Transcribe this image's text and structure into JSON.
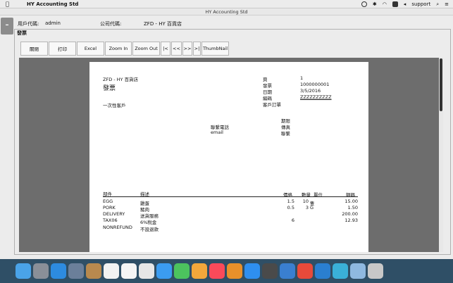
{
  "menubar": {
    "app_name": "HY Accounting Std",
    "user": "support"
  },
  "window": {
    "title": "HY Accounting Std"
  },
  "info": {
    "user_label": "用戶代碼:",
    "user_value": "admin",
    "company_label": "公司代碼:",
    "company_value": "ZFD - HY 百貨店"
  },
  "panel": {
    "title": "發票"
  },
  "toolbar": {
    "close": "關閉",
    "print": "打印",
    "excel": "Excel",
    "zoom_in": "Zoom In",
    "zoom_out": "Zoom Out",
    "first": "|<",
    "prev": "<<",
    "next": ">>",
    "last": ">|",
    "thumbnail": "ThumbNail"
  },
  "report": {
    "company": "ZFD - HY 百貨店",
    "doc_title": "發票",
    "customer": "一次性客戶",
    "page_label": "頁",
    "page_value": "1",
    "invoice_label": "發票",
    "invoice_value": "1000000001",
    "date_label": "日期",
    "date_value": "3/5/2016",
    "code_label": "編碼",
    "code_value": "ZZZZZZZZZZ",
    "cust_order_label": "客戶訂單",
    "due_label": "期限",
    "fax_label": "傳真",
    "contact_label": "聯繫",
    "phone_label": "聯繫電話",
    "email_label": "email",
    "col_part": "部件",
    "col_desc": "描述",
    "col_price": "價格",
    "col_qty": "數量",
    "col_unit": "單位",
    "col_amount": "額碼",
    "lines": [
      {
        "part": "EGG",
        "desc": "雞蛋",
        "price": "1.5",
        "qty": "10",
        "unit": "隻",
        "amount": "15.00"
      },
      {
        "part": "PORK",
        "desc": "豬肉",
        "price": "0.5",
        "qty": "3",
        "unit": "G",
        "amount": "1.50"
      },
      {
        "part": "DELIVERY",
        "desc": "送貨服務",
        "price": "",
        "qty": "",
        "unit": "",
        "amount": "200.00"
      },
      {
        "part": "TAX06",
        "desc": "6%稅金",
        "price": "6",
        "qty": "",
        "unit": "",
        "amount": "12.93"
      },
      {
        "part": "NONREFUND",
        "desc": "不設退款",
        "price": "",
        "qty": "",
        "unit": "",
        "amount": ""
      }
    ]
  },
  "dock": {
    "colors": [
      "#4aa3e8",
      "#8a8f98",
      "#2d8be0",
      "#6b7f9a",
      "#b8894e",
      "#f2f2f2",
      "#f5f5f5",
      "#e6e6e6",
      "#3b9cf0",
      "#4cc35e",
      "#f3a73b",
      "#fa4a5a",
      "#e8902a",
      "#2e8ff0",
      "#4a4a4a",
      "#3a7fd0",
      "#e84a3a",
      "#2a7fd0",
      "#3ab0d8",
      "#8fb9e0",
      "#c8c8c8"
    ]
  }
}
